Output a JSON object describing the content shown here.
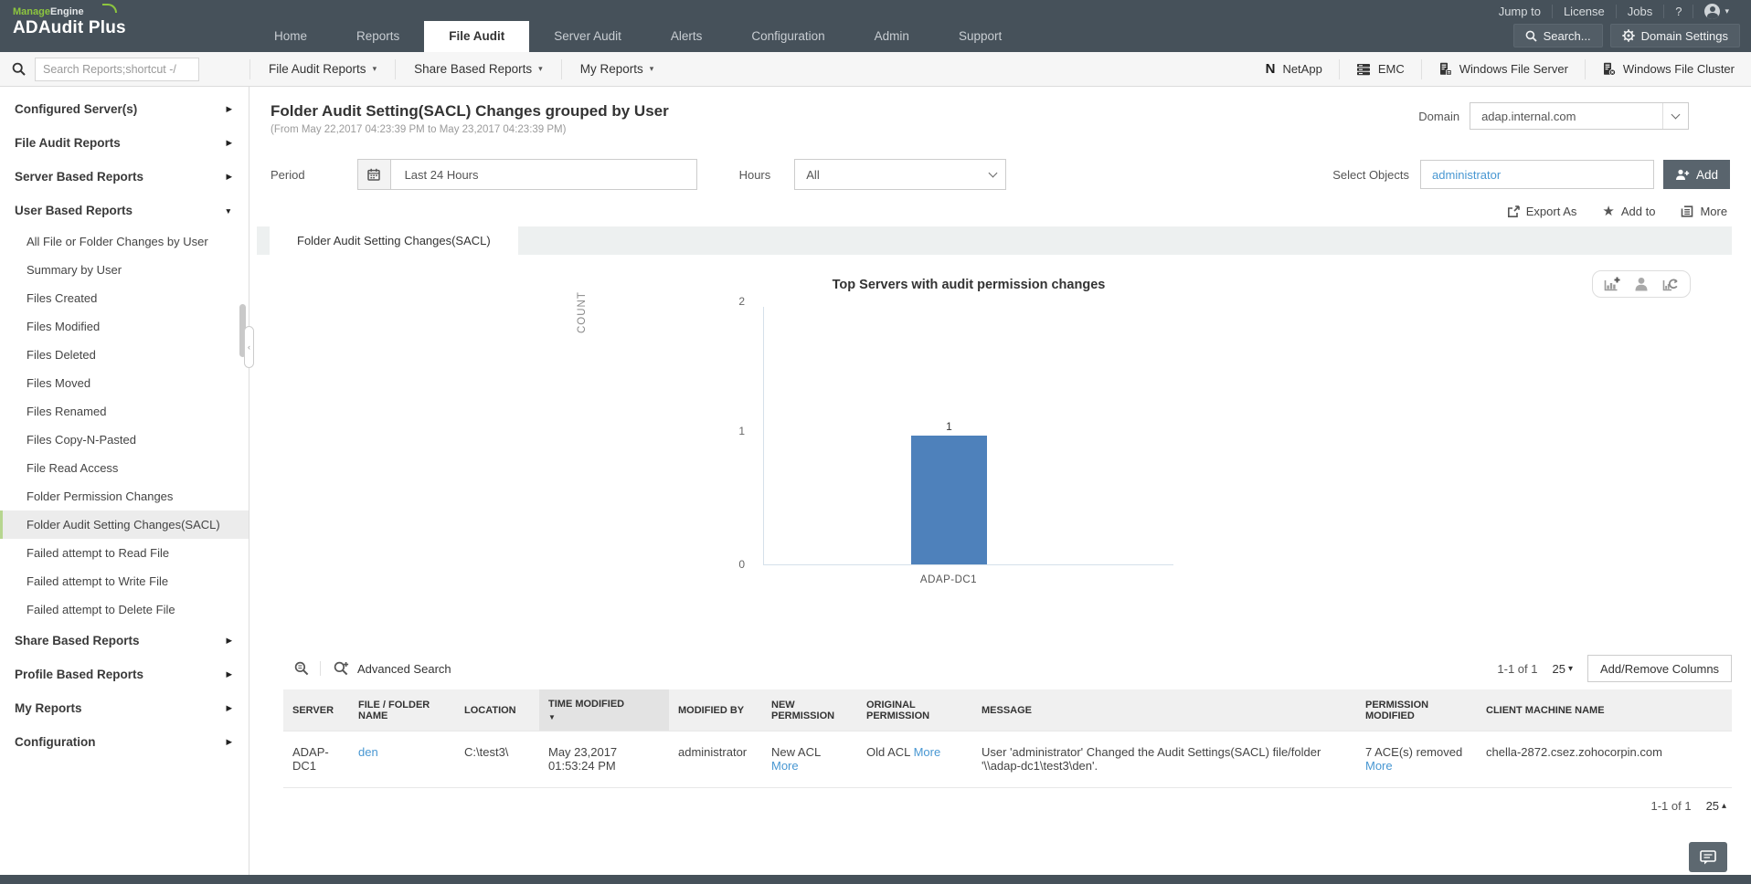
{
  "colors": {
    "header": "#46515a",
    "accent_green": "#8dc63f",
    "link_blue": "#4897d2",
    "bar_blue": "#4e81bb",
    "sidebar_active_border": "#b7d690"
  },
  "icons": {
    "caret_down": "▾",
    "caret_up": "▴",
    "chevron_right": "▶",
    "chevron_down": "▼",
    "sort_down": "▼",
    "star": "★"
  },
  "brand": {
    "manage": "Manage",
    "engine": "Engine",
    "product": "ADAudit Plus"
  },
  "topnav": {
    "tabs": [
      "Home",
      "Reports",
      "File Audit",
      "Server Audit",
      "Alerts",
      "Configuration",
      "Admin",
      "Support"
    ],
    "active_index": 2,
    "links": [
      "Jump to",
      "License",
      "Jobs"
    ],
    "help_label": "?",
    "search_button": "Search...",
    "domain_settings_button": "Domain Settings"
  },
  "toolbar": {
    "search_placeholder": "Search Reports;shortcut -/",
    "menus": [
      "File Audit Reports",
      "Share Based Reports",
      "My Reports"
    ],
    "server_types": [
      "NetApp",
      "EMC",
      "Windows File Server",
      "Windows File Cluster"
    ]
  },
  "sidebar": {
    "sections_top": [
      "Configured Server(s)",
      "File Audit Reports",
      "Server Based Reports"
    ],
    "expanded_section": "User Based Reports",
    "user_based_items": [
      "All File or Folder Changes by User",
      "Summary by User",
      "Files Created",
      "Files Modified",
      "Files Deleted",
      "Files Moved",
      "Files Renamed",
      "Files Copy-N-Pasted",
      "File Read Access",
      "Folder Permission Changes",
      "Folder Audit Setting Changes(SACL)",
      "Failed attempt to Read File",
      "Failed attempt to Write File",
      "Failed attempt to Delete File"
    ],
    "active_index": 10,
    "sections_bottom": [
      "Share Based Reports",
      "Profile Based Reports",
      "My Reports",
      "Configuration"
    ]
  },
  "page": {
    "title": "Folder Audit Setting(SACL) Changes grouped by User",
    "subtitle": "(From May 22,2017 04:23:39 PM to May 23,2017 04:23:39 PM)",
    "domain_label": "Domain",
    "domain_value": "adap.internal.com"
  },
  "filters": {
    "period_label": "Period",
    "period_value": "Last 24 Hours",
    "hours_label": "Hours",
    "hours_value": "All",
    "select_objects_label": "Select Objects",
    "select_objects_value": "administrator",
    "add_button": "Add"
  },
  "actions": {
    "export_as": "Export As",
    "add_to": "Add to",
    "more": "More"
  },
  "report_tab": "Folder Audit Setting Changes(SACL)",
  "chart_data": {
    "type": "bar",
    "title": "Top Servers with audit permission changes",
    "categories": [
      "ADAP-DC1"
    ],
    "values": [
      1
    ],
    "xlabel": "",
    "ylabel": "COUNT",
    "ylim": [
      0,
      2
    ],
    "yticks": [
      0,
      1,
      2
    ],
    "bar_color": "#4e81bb",
    "grid": false,
    "legend": false
  },
  "table": {
    "advanced_search_label": "Advanced Search",
    "pagination_top": "1-1 of 1",
    "page_size": "25",
    "add_remove_columns": "Add/Remove Columns",
    "more_label": "More",
    "columns": [
      "SERVER",
      "FILE / FOLDER NAME",
      "LOCATION",
      "TIME MODIFIED",
      "MODIFIED BY",
      "NEW PERMISSION",
      "ORIGINAL PERMISSION",
      "MESSAGE",
      "PERMISSION MODIFIED",
      "CLIENT MACHINE NAME"
    ],
    "rows": [
      {
        "server": "ADAP-DC1",
        "file_name": "den",
        "location": "C:\\test3\\",
        "time_modified": "May 23,2017 01:53:24 PM",
        "modified_by": "administrator",
        "new_permission": "New ACL",
        "original_permission": "Old ACL",
        "message": "User 'administrator' Changed the Audit Settings(SACL) file/folder '\\\\adap-dc1\\test3\\den'.",
        "permission_modified": "7 ACE(s) removed",
        "client_machine": "chella-2872.csez.zohocorpin.com"
      }
    ],
    "pagination_bottom": "1-1 of 1"
  }
}
